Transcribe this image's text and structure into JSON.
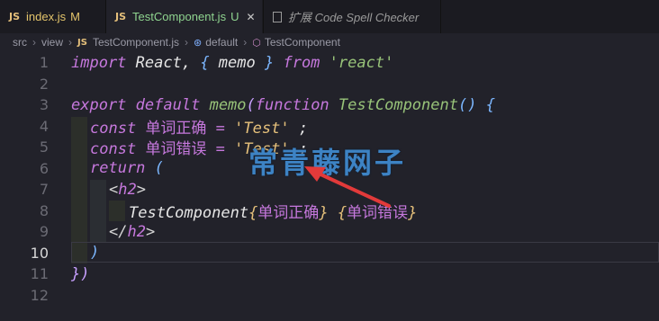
{
  "tabs": [
    {
      "label": "index.js",
      "status": "M"
    },
    {
      "label": "TestComponent.js",
      "status": "U"
    },
    {
      "label": "扩展 Code Spell Checker"
    }
  ],
  "breadcrumb": [
    "src",
    "view",
    "TestComponent.js",
    "default",
    "TestComponent"
  ],
  "line_numbers": [
    "1",
    "2",
    "3",
    "4",
    "5",
    "6",
    "7",
    "8",
    "9",
    "10",
    "11",
    "12"
  ],
  "code": {
    "l1": [
      "import",
      " React, ",
      "{",
      " memo ",
      "}",
      " from ",
      "'react'"
    ],
    "l3": [
      "export",
      " ",
      "default",
      " ",
      "memo",
      "(",
      "function",
      " ",
      "TestComponent",
      "()",
      " ",
      "{"
    ],
    "l4": [
      "const",
      " ",
      "单词正确",
      " = ",
      "'Test'",
      " ;"
    ],
    "l5": [
      "const",
      " ",
      "单词错误",
      " = ",
      "'Test'",
      " ;"
    ],
    "l6": [
      "return",
      " ",
      "("
    ],
    "l7": [
      "<",
      "h2",
      ">"
    ],
    "l8": [
      "TestComponent",
      "{",
      "单词正确",
      "}",
      " ",
      "{",
      "单词错误",
      "}"
    ],
    "l9": [
      "</",
      "h2",
      ">"
    ],
    "l10": [
      ")"
    ],
    "l11": [
      "})"
    ]
  },
  "watermark": "常青藤网子",
  "colors": {
    "background": "#22222a",
    "arrow": "#e23a3a",
    "watermark": "#3d83c4"
  }
}
